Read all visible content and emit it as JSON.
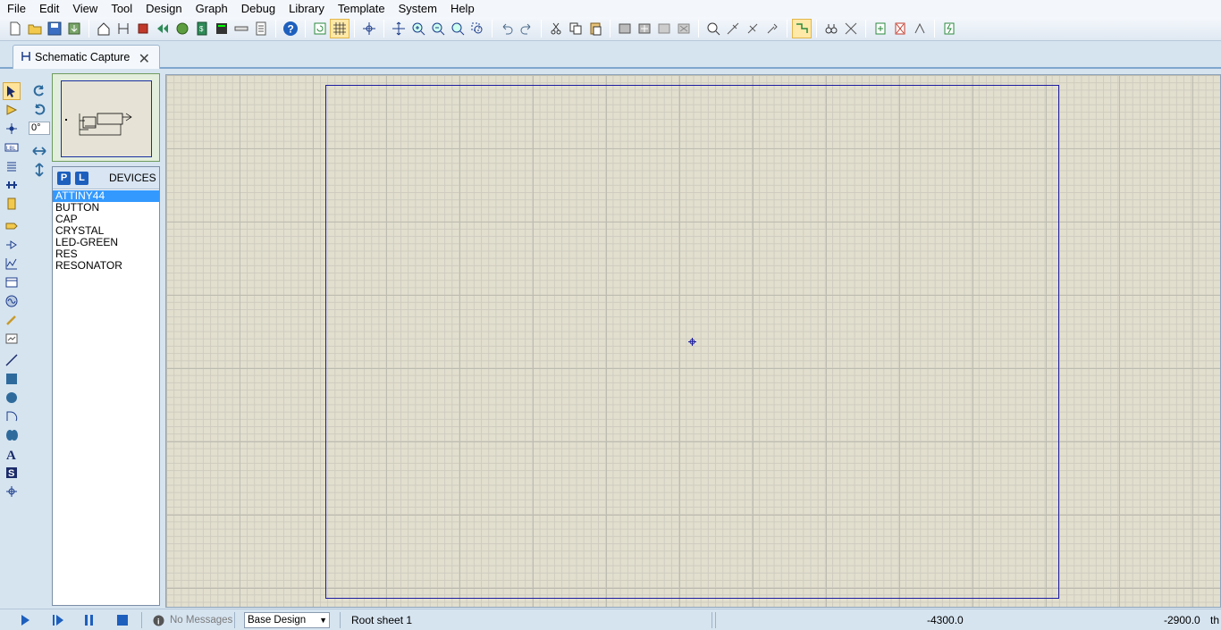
{
  "menu": [
    "File",
    "Edit",
    "View",
    "Tool",
    "Design",
    "Graph",
    "Debug",
    "Library",
    "Template",
    "System",
    "Help"
  ],
  "tab": {
    "label": "Schematic Capture"
  },
  "rotation": {
    "angle": "0°"
  },
  "devices": {
    "header": "DEVICES",
    "p_button": "P",
    "l_button": "L",
    "items": [
      "ATTINY44",
      "BUTTON",
      "CAP",
      "CRYSTAL",
      "LED-GREEN",
      "RES",
      "RESONATOR"
    ],
    "selected": "ATTINY44"
  },
  "status": {
    "messages": "No Messages",
    "design": "Base Design",
    "sheet": "Root sheet 1",
    "x_coord": "-4300.0",
    "y_coord": "-2900.0",
    "units": "th"
  },
  "colors": {
    "selection": "#3399ff",
    "sheet_border": "#1b1ba0",
    "canvas": "#e2dfcf"
  }
}
